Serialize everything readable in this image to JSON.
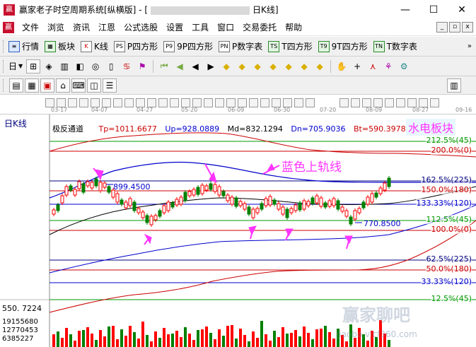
{
  "window": {
    "app_logo": "赢",
    "title_prefix": "赢家老子时空周期系统[纵横版] - [",
    "title_suffix": "日K线]",
    "minimize": "—",
    "maximize": "☐",
    "close": "✕"
  },
  "menu": {
    "items": [
      "文件",
      "浏览",
      "资讯",
      "江恩",
      "公式选股",
      "设置",
      "工具",
      "窗口",
      "交易委托",
      "帮助"
    ],
    "mdi_buttons": [
      "_",
      "▫",
      "x"
    ]
  },
  "toolbar1": {
    "items": [
      {
        "icon": "≡",
        "label": "行情"
      },
      {
        "icon": "▦",
        "label": "板块"
      },
      {
        "icon": "K",
        "label": "K线"
      },
      {
        "icon": "PS",
        "label": "P四方形"
      },
      {
        "icon": "P9",
        "label": "9P四方形"
      },
      {
        "icon": "PN",
        "label": "P数字表"
      },
      {
        "icon": "TS",
        "label": "T四方形"
      },
      {
        "icon": "T9",
        "label": "9T四方形"
      },
      {
        "icon": "TN",
        "label": "T数字表"
      }
    ],
    "more": "»"
  },
  "toolbar2": {
    "first_label": "日",
    "buttons": [
      "⊞",
      "◈",
      "▥",
      "◧",
      "◎",
      "▯",
      "♋",
      "⚑",
      "⏮",
      "◀",
      "◀",
      "▶",
      "◆",
      "◆",
      "◆",
      "◆",
      "◆",
      "◆",
      "◆",
      "✋",
      "+",
      "⋏",
      "⚘",
      "⚙"
    ]
  },
  "toolbar3": {
    "buttons": [
      "▤",
      "▦",
      "▣",
      "⌂",
      "⌨",
      "◫",
      "☰"
    ],
    "trailing": "▥"
  },
  "datebar": {
    "dates": [
      "03-17",
      "04-07",
      "04-27",
      "05-20",
      "06-09",
      "06-30",
      "07-20",
      "08-09",
      "08-27",
      "09-16"
    ]
  },
  "chart": {
    "period_label": "日K线",
    "indicator_name": "极反通道",
    "tp": "Tp=1011.6677",
    "up": "Up=928.0889",
    "md": "Md=832.1294",
    "dn": "Dn=705.9036",
    "bt": "Bt=590.3978",
    "sector_label": "水电板块",
    "annotation": "蓝色上轨线",
    "high_label": "899.4500",
    "low_label": "770.8500",
    "volume_high": "550. 7224",
    "volume_axis": [
      "19155680",
      "12770453",
      "6385227"
    ],
    "watermark_text": "赢家聊吧",
    "watermark_url": "jiaoba.vicf360.com",
    "levels": [
      {
        "label": "212.5%(45)",
        "color": "#009900"
      },
      {
        "label": "200.0%(0)",
        "color": "#cc0000"
      },
      {
        "label": "162.5%(225)",
        "color": "#000080"
      },
      {
        "label": "150.0%(180)",
        "color": "#cc0000"
      },
      {
        "label": "133.33%(120)",
        "color": "#0000cc"
      },
      {
        "label": "112.5%(45)",
        "color": "#009900"
      },
      {
        "label": "100.0%(0)",
        "color": "#cc0000"
      },
      {
        "label": "62.5%(225)",
        "color": "#000080"
      },
      {
        "label": "50.0%(180)",
        "color": "#cc0000"
      },
      {
        "label": "33.33%(120)",
        "color": "#0000cc"
      },
      {
        "label": "12.5%(45)",
        "color": "#009900"
      }
    ],
    "colors": {
      "up_candle": "#ff0000",
      "down_candle": "#008000",
      "upper_band": "#cc0000",
      "mid_band": "#0000cc",
      "lower_band": "#000000",
      "highlight": "#ff33ff"
    }
  }
}
